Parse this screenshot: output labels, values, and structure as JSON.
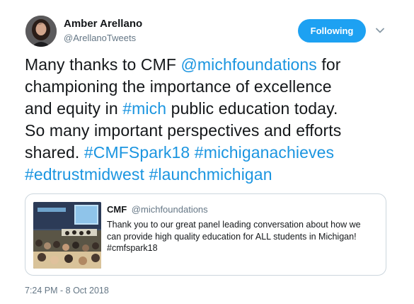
{
  "author": {
    "name": "Amber Arellano",
    "handle": "@ArellanoTweets",
    "avatar_icon": "profile-photo"
  },
  "follow_button": {
    "label": "Following",
    "color": "#1da1f2"
  },
  "menu": {
    "icon": "chevron-down-icon"
  },
  "tweet": {
    "lines": [
      [
        {
          "text": "Many thanks to CMF "
        },
        {
          "text": "@michfoundations",
          "link": true
        },
        {
          "text": " for"
        }
      ],
      [
        {
          "text": "championing the importance of excellence"
        }
      ],
      [
        {
          "text": "and equity in "
        },
        {
          "text": "#mich",
          "link": true
        },
        {
          "text": " public education today."
        }
      ],
      [
        {
          "text": "So many important perspectives and efforts"
        }
      ],
      [
        {
          "text": "shared. "
        },
        {
          "text": "#CMFSpark18",
          "link": true
        },
        {
          "text": " "
        },
        {
          "text": "#michiganachieves",
          "link": true
        }
      ],
      [
        {
          "text": "#edtrustmidwest",
          "link": true
        },
        {
          "text": " "
        },
        {
          "text": "#launchmichigan",
          "link": true
        }
      ]
    ],
    "link_color": "#1b95e0"
  },
  "quoted_tweet": {
    "name": "CMF",
    "handle": "@michfoundations",
    "lines": [
      "Thank you to our great panel leading conversation about how we",
      "can provide high quality education for ALL students in Michigan!",
      "#cmfspark18"
    ],
    "image_icon": "conference-panel-photo"
  },
  "timestamp": "7:24 PM - 8 Oct 2018"
}
